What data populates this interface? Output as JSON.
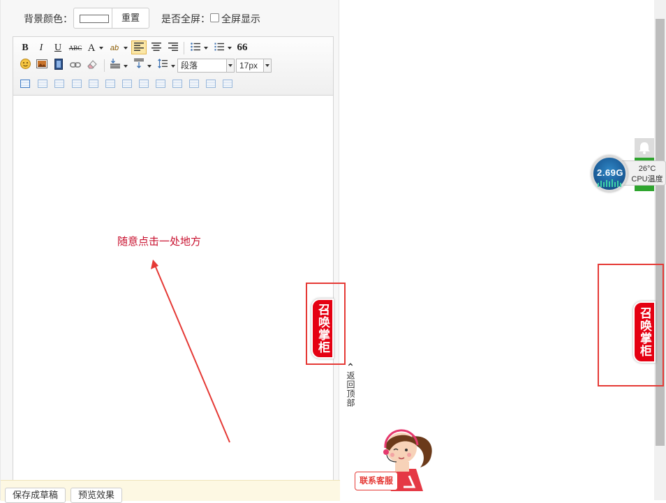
{
  "topbar": {
    "bg_color_label": "背景颜色：",
    "reset_label": "重置",
    "fullscreen_label": "是否全屏：",
    "fullscreen_checkbox_label": "全屏显示"
  },
  "toolbar": {
    "bold": "B",
    "italic": "I",
    "underline": "U",
    "strike": "ABC",
    "font_color": "A",
    "highlight": "ab",
    "quote": "66",
    "paragraph": "段落",
    "font_size": "17px"
  },
  "annotation": {
    "text": "随意点击一处地方",
    "color": "#c8102e"
  },
  "bottombar": {
    "save_draft": "保存成草稿",
    "preview": "预览效果"
  },
  "summon": {
    "label": "召唤掌柜",
    "color": "#e50012"
  },
  "back_to_top": {
    "arrow": "⌃",
    "label": "返回顶部"
  },
  "cpu_widget": {
    "frequency": "2.69G",
    "temperature": "26°C",
    "label": "CPU温度"
  },
  "support": {
    "label": "联系客服"
  }
}
